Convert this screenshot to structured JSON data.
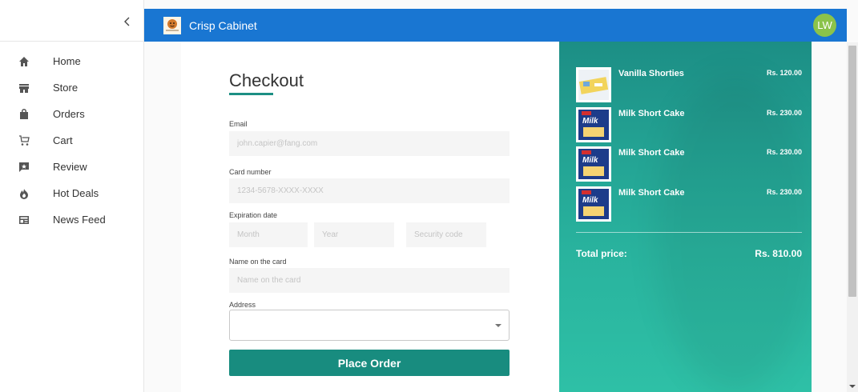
{
  "app": {
    "title": "Crisp Cabinet",
    "user_initials": "LW"
  },
  "sidebar": {
    "items": [
      {
        "label": "Home",
        "icon": "home-icon"
      },
      {
        "label": "Store",
        "icon": "store-icon"
      },
      {
        "label": "Orders",
        "icon": "orders-icon"
      },
      {
        "label": "Cart",
        "icon": "cart-icon"
      },
      {
        "label": "Review",
        "icon": "review-icon"
      },
      {
        "label": "Hot Deals",
        "icon": "hot-deals-icon"
      },
      {
        "label": "News Feed",
        "icon": "news-feed-icon"
      }
    ]
  },
  "checkout": {
    "title": "Checkout",
    "email_label": "Email",
    "email_placeholder": "john.capier@fang.com",
    "card_label": "Card number",
    "card_placeholder": "1234-5678-XXXX-XXXX",
    "expiry_label": "Expiration date",
    "month_placeholder": "Month",
    "year_placeholder": "Year",
    "security_placeholder": "Security code",
    "name_label": "Name on the card",
    "name_placeholder": "Name on the card",
    "address_label": "Address",
    "address_value": "",
    "place_order_label": "Place Order"
  },
  "summary": {
    "items": [
      {
        "name": "Vanilla Shorties",
        "price": "Rs. 120.00"
      },
      {
        "name": "Milk Short Cake",
        "price": "Rs. 230.00"
      },
      {
        "name": "Milk Short Cake",
        "price": "Rs. 230.00"
      },
      {
        "name": "Milk Short Cake",
        "price": "Rs. 230.00"
      }
    ],
    "total_label": "Total price:",
    "total_value": "Rs. 810.00"
  },
  "colors": {
    "header": "#1976d2",
    "accent": "#188c7f",
    "avatar": "#8bc34a"
  }
}
